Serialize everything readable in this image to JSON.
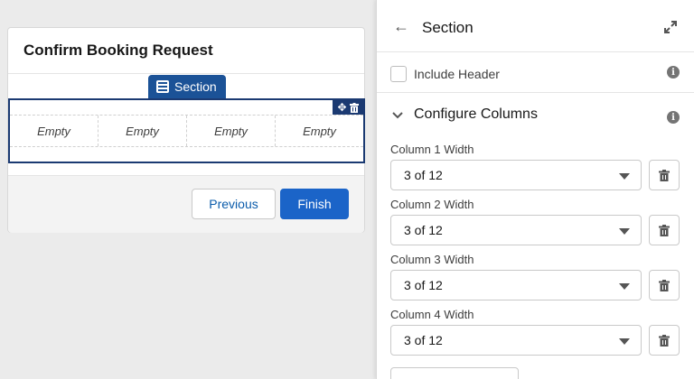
{
  "canvas": {
    "card_title": "Confirm Booking Request",
    "section_tab_label": "Section",
    "columns": [
      "Empty",
      "Empty",
      "Empty",
      "Empty"
    ],
    "previous_label": "Previous",
    "finish_label": "Finish",
    "tools_icons": [
      "move-icon",
      "trash-icon"
    ]
  },
  "panel": {
    "title": "Section",
    "include_header_label": "Include Header",
    "include_header_checked": false,
    "configure_columns_label": "Configure Columns",
    "fields": [
      {
        "label": "Column 1 Width",
        "value": "3 of 12"
      },
      {
        "label": "Column 2 Width",
        "value": "3 of 12"
      },
      {
        "label": "Column 3 Width",
        "value": "3 of 12"
      },
      {
        "label": "Column 4 Width",
        "value": "3 of 12"
      }
    ]
  },
  "colors": {
    "section_tab": "#1b5297",
    "section_border": "#1b3a72",
    "finish_button": "#1b64c8",
    "link_blue": "#0b5cab"
  }
}
